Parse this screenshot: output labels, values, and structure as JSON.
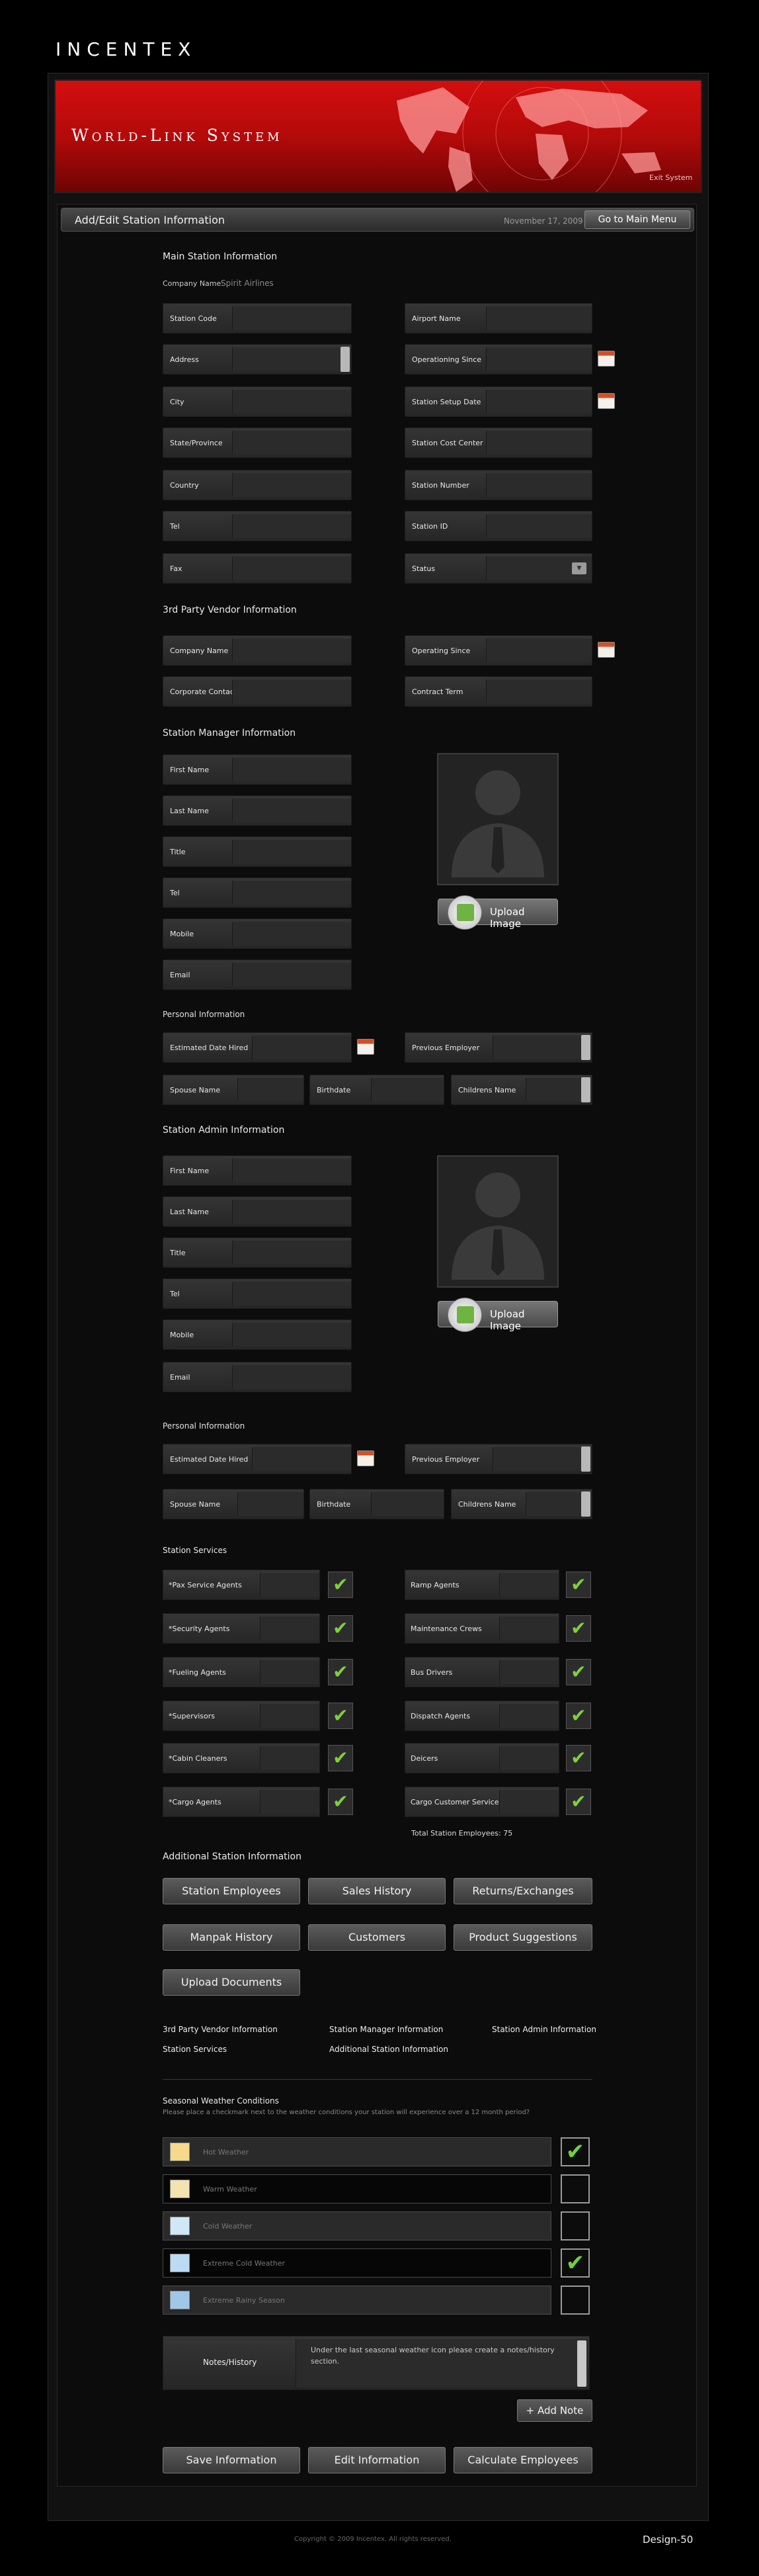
{
  "header": {
    "logo": "INCENTEX",
    "banner_title": "World-Link System",
    "exit": "Exit System"
  },
  "titlebar": {
    "title": "Add/Edit Station Information",
    "date": "November 17, 2009",
    "menu": "Go to Main Menu"
  },
  "main": {
    "heading": "Main Station Information",
    "company_label": "Company Name:",
    "company_value": "Spirit Airlines",
    "left": [
      "Station Code",
      "Address",
      "City",
      "State/Province",
      "Country",
      "Tel",
      "Fax"
    ],
    "right": [
      "Airport Name",
      "Operationing Since",
      "Station Setup Date",
      "Station Cost Center",
      "Station Number",
      "Station ID",
      "Status"
    ]
  },
  "vendor": {
    "heading": "3rd Party Vendor Information",
    "left": [
      "Company Name",
      "Corporate Contact"
    ],
    "right": [
      "Operating Since",
      "Contract Term"
    ]
  },
  "manager": {
    "heading": "Station Manager Information",
    "fields": [
      "First Name",
      "Last Name",
      "Title",
      "Tel",
      "Mobile",
      "Email"
    ],
    "upload": "Upload Image",
    "personal_heading": "Personal Information",
    "personal": [
      "Estimated Date Hired",
      "Previous Employer",
      "Spouse Name",
      "Birthdate",
      "Childrens Name"
    ]
  },
  "admin": {
    "heading": "Station Admin Information",
    "fields": [
      "First Name",
      "Last Name",
      "Title",
      "Tel",
      "Mobile",
      "Email"
    ],
    "upload": "Upload Image",
    "personal_heading": "Personal Information",
    "personal": [
      "Estimated Date Hired",
      "Previous Employer",
      "Spouse Name",
      "Birthdate",
      "Childrens Name"
    ]
  },
  "services": {
    "heading": "Station Services",
    "left": [
      "*Pax Service Agents",
      "*Security Agents",
      "*Fueling Agents",
      "*Supervisors",
      "*Cabin Cleaners",
      "*Cargo Agents"
    ],
    "right": [
      "Ramp Agents",
      "Maintenance Crews",
      "Bus Drivers",
      "Dispatch Agents",
      "Deicers",
      "Cargo Customer Service"
    ],
    "check": "✔",
    "total": "Total Station Employees: 75"
  },
  "additional": {
    "heading": "Additional Station Information",
    "buttons": [
      "Station Employees",
      "Sales History",
      "Returns/Exchanges",
      "Manpak History",
      "Customers",
      "Product Suggestions",
      "Upload Documents"
    ],
    "links": [
      "3rd Party Vendor Information",
      "Station Manager Information",
      "Station Admin Information",
      "Station Services",
      "Additional Station Information"
    ]
  },
  "weather": {
    "heading": "Seasonal Weather Conditions",
    "desc": "Please place a checkmark next to the weather conditions your station will experience over a 12 month period?",
    "rows": [
      {
        "label": "Hot Weather",
        "check": "✔"
      },
      {
        "label": "Warm Weather",
        "check": ""
      },
      {
        "label": "Cold Weather",
        "check": ""
      },
      {
        "label": "Extreme Cold Weather",
        "check": "✔"
      },
      {
        "label": "Extreme Rainy Season",
        "check": ""
      }
    ],
    "notes_label": "Notes/History",
    "notes_text": "Under the last seasonal weather icon please create a notes/history section.",
    "add_note": "+ Add Note"
  },
  "actions": [
    "Save Information",
    "Edit Information",
    "Calculate Employees"
  ],
  "footer": {
    "copyright": "Copyright © 2009 Incentex. All rights reserved.",
    "design": "Design-50"
  }
}
